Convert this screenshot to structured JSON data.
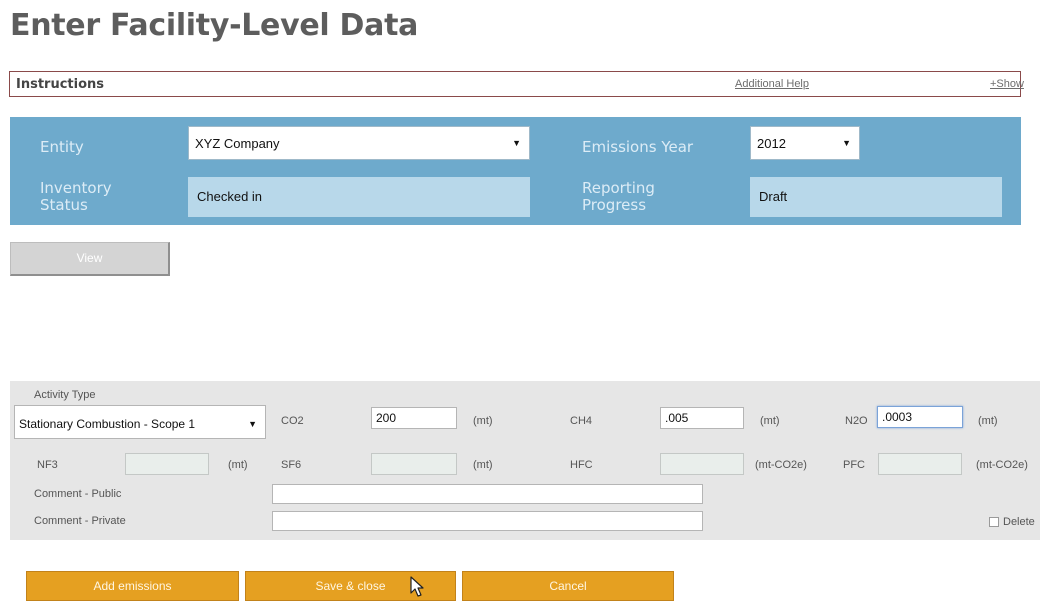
{
  "page": {
    "title": "Enter Facility-Level Data"
  },
  "instructions": {
    "label": "Instructions",
    "help_link": "Additional Help",
    "show_link": "+Show"
  },
  "header_panel": {
    "entity_label": "Entity",
    "entity_value": "XYZ Company",
    "year_label": "Emissions Year",
    "year_value": "2012",
    "inventory_label_1": "Inventory",
    "inventory_label_2": "Status",
    "inventory_value": "Checked in",
    "progress_label_1": "Reporting",
    "progress_label_2": "Progress",
    "progress_value": "Draft"
  },
  "view_button": "View",
  "activity": {
    "type_label": "Activity Type",
    "type_value": "Stationary Combustion - Scope 1",
    "co2": {
      "label": "CO2",
      "value": "200",
      "unit": "(mt)"
    },
    "ch4": {
      "label": "CH4",
      "value": ".005",
      "unit": "(mt)"
    },
    "n2o": {
      "label": "N2O",
      "value": ".0003",
      "unit": "(mt)"
    },
    "nf3": {
      "label": "NF3",
      "value": "",
      "unit": "(mt)"
    },
    "sf6": {
      "label": "SF6",
      "value": "",
      "unit": "(mt)"
    },
    "hfc": {
      "label": "HFC",
      "value": "",
      "unit": "(mt-CO2e)"
    },
    "pfc": {
      "label": "PFC",
      "value": "",
      "unit": "(mt-CO2e)"
    },
    "comment_public_label": "Comment - Public",
    "comment_public_value": "",
    "comment_private_label": "Comment - Private",
    "comment_private_value": "",
    "delete_label": "Delete"
  },
  "buttons": {
    "add": "Add emissions",
    "save": "Save & close",
    "cancel": "Cancel"
  },
  "colors": {
    "header_blue": "#6eaacc",
    "readonly_blue": "#b8d8ea",
    "action_orange": "#e5a021",
    "panel_gray": "#e6e6e6"
  }
}
